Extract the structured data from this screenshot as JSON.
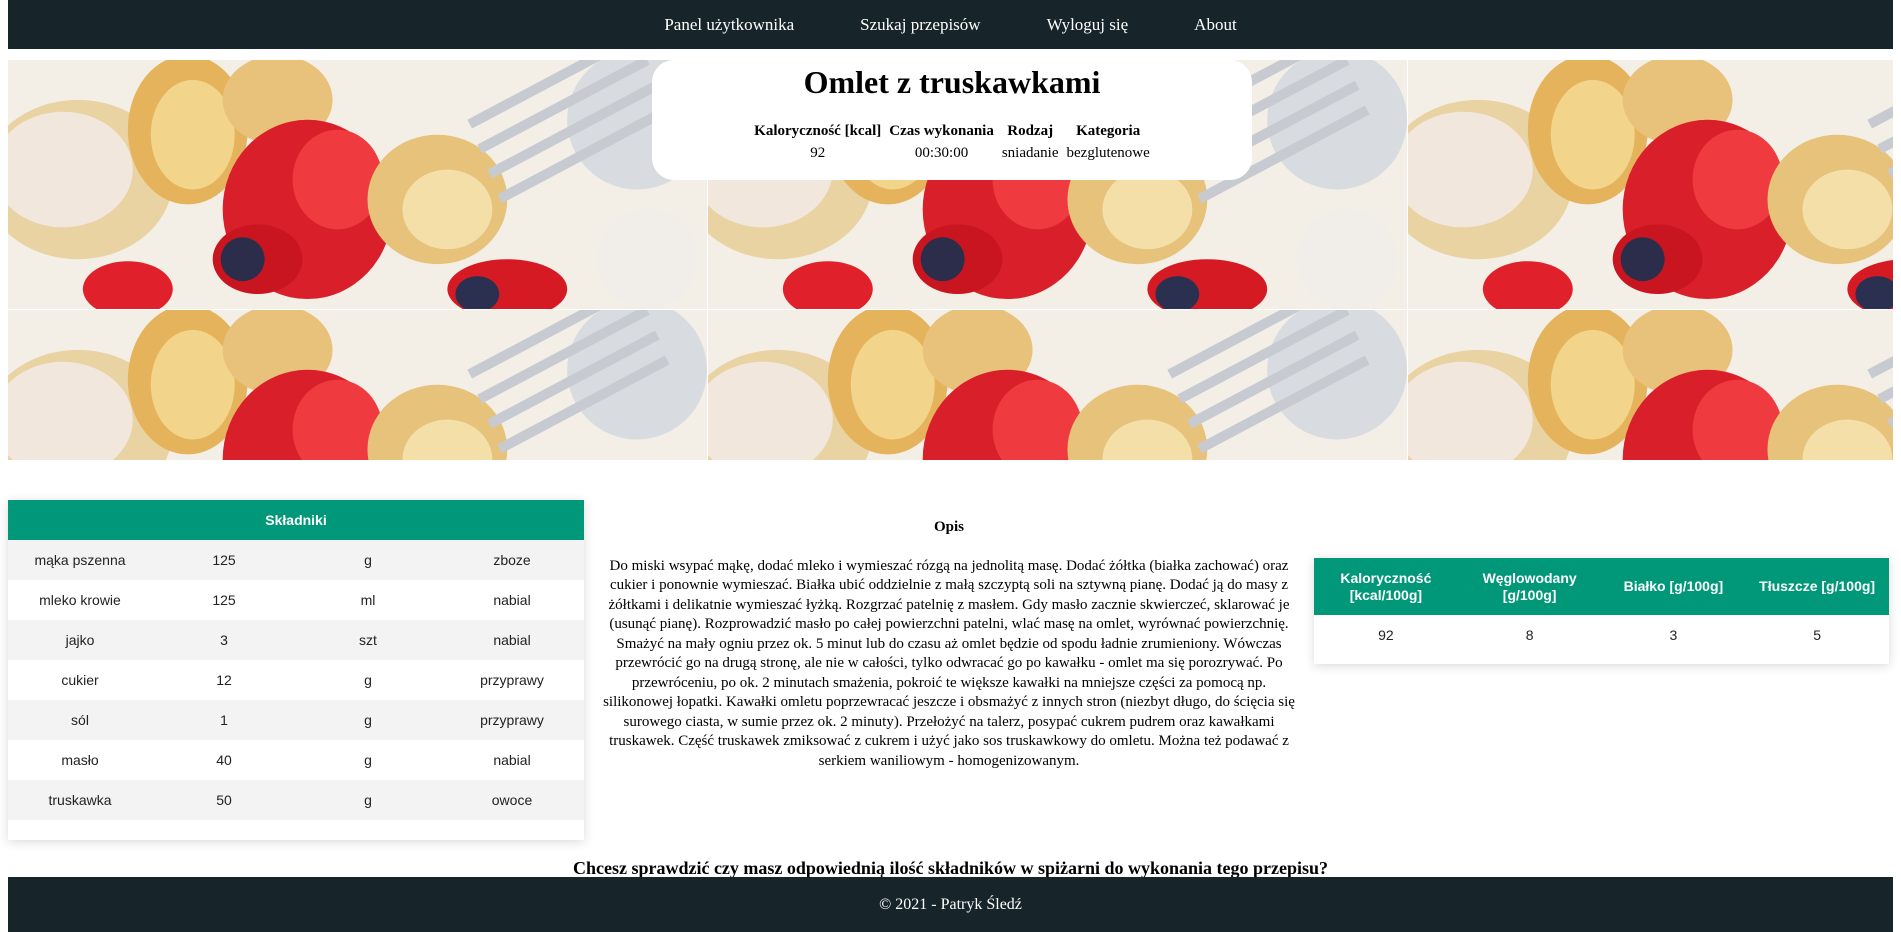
{
  "nav": {
    "items": [
      "Panel użytkownika",
      "Szukaj przepisów",
      "Wyloguj się",
      "About"
    ]
  },
  "hero": {
    "image_subject": "strawberry-omelet-photo"
  },
  "recipe": {
    "title": "Omlet z truskawkami",
    "info_headers": [
      "Kaloryczność [kcal]",
      "Czas wykonania",
      "Rodzaj",
      "Kategoria"
    ],
    "calories": "92",
    "time": "00:30:00",
    "type": "sniadanie",
    "category": "bezglutenowe"
  },
  "ingredients": {
    "header": "Składniki",
    "rows": [
      [
        "mąka pszenna",
        "125",
        "g",
        "zboze"
      ],
      [
        "mleko krowie",
        "125",
        "ml",
        "nabial"
      ],
      [
        "jajko",
        "3",
        "szt",
        "nabial"
      ],
      [
        "cukier",
        "12",
        "g",
        "przyprawy"
      ],
      [
        "sól",
        "1",
        "g",
        "przyprawy"
      ],
      [
        "masło",
        "40",
        "g",
        "nabial"
      ],
      [
        "truskawka",
        "50",
        "g",
        "owoce"
      ]
    ]
  },
  "description": {
    "title": "Opis",
    "text": "Do miski wsypać mąkę, dodać mleko i wymieszać rózgą na jednolitą masę. Dodać żółtka (białka zachować) oraz cukier i ponownie wymieszać. Białka ubić oddzielnie z małą szczyptą soli na sztywną pianę. Dodać ją do masy z żółtkami i delikatnie wymieszać łyżką. Rozgrzać patelnię z masłem. Gdy masło zacznie skwierczeć, sklarować je (usunąć pianę). Rozprowadzić masło po całej powierzchni patelni, wlać masę na omlet, wyrównać powierzchnię. Smażyć na mały ogniu przez ok. 5 minut lub do czasu aż omlet będzie od spodu ładnie zrumieniony. Wówczas przewrócić go na drugą stronę, ale nie w całości, tylko odwracać go po kawałku - omlet ma się porozrywać. Po przewróceniu, po ok. 2 minutach smażenia, pokroić te większe kawałki na mniejsze części za pomocą np. silikonowej łopatki. Kawałki omletu poprzewracać jeszcze i obsmażyć z innych stron (niezbyt długo, do ścięcia się surowego ciasta, w sumie przez ok. 2 minuty). Przełożyć na talerz, posypać cukrem pudrem oraz kawałkami truskawek. Część truskawek zmiksować z cukrem i użyć jako sos truskawkowy do omletu. Można też podawać z serkiem waniliowym - homogenizowanym."
  },
  "nutrition": {
    "headers": [
      "Kaloryczność [kcal/100g]",
      "Węglowodany [g/100g]",
      "Białko [g/100g]",
      "Tłuszcze [g/100g]"
    ],
    "values": [
      "92",
      "8",
      "3",
      "5"
    ]
  },
  "question": "Chcesz sprawdzić czy masz odpowiednią ilość składników w spiżarni do wykonania tego przepisu?",
  "footer": "© 2021 - Patryk Śledź",
  "colors": {
    "navbar": "#17252a",
    "table_header": "#009879",
    "zebra": "#f3f3f3"
  }
}
